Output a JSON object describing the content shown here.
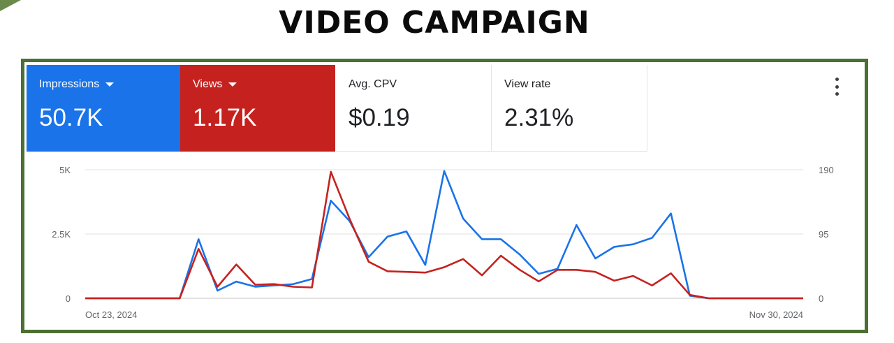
{
  "page": {
    "title": "VIDEO  CAMPAIGN"
  },
  "metrics": [
    {
      "label": "Impressions",
      "value": "50.7K",
      "color": "#1a73e8"
    },
    {
      "label": "Views",
      "value": "1.17K",
      "color": "#c5221f"
    },
    {
      "label": "Avg. CPV",
      "value": "$0.19"
    },
    {
      "label": "View rate",
      "value": "2.31%"
    }
  ],
  "icons": {
    "menu": "more-vert-icon",
    "dropdown": "caret-down-icon"
  },
  "chart_data": {
    "type": "line",
    "x_start_label": "Oct 23, 2024",
    "x_end_label": "Nov 30, 2024",
    "x_range": [
      "2024-10-23",
      "2024-11-30"
    ],
    "left_axis": {
      "ticks": [
        "0",
        "2.5K",
        "5K"
      ],
      "ylim": [
        0,
        5000
      ]
    },
    "right_axis": {
      "ticks": [
        "0",
        "95",
        "190"
      ],
      "ylim": [
        0,
        190
      ]
    },
    "grid": true,
    "series": [
      {
        "name": "Impressions",
        "axis": "left",
        "color": "#1a73e8",
        "values": [
          0,
          0,
          0,
          0,
          0,
          0,
          2300,
          300,
          650,
          450,
          500,
          550,
          750,
          3800,
          3000,
          1600,
          2400,
          2600,
          1300,
          4950,
          3100,
          2300,
          2300,
          1700,
          950,
          1150,
          2850,
          1550,
          2000,
          2100,
          2350,
          3300,
          100,
          0,
          0,
          0,
          0,
          0,
          0
        ]
      },
      {
        "name": "Views",
        "axis": "right",
        "color": "#c5221f",
        "values": [
          0,
          0,
          0,
          0,
          0,
          0,
          73,
          17,
          50,
          20,
          21,
          17,
          16,
          187,
          117,
          54,
          40,
          39,
          38,
          46,
          58,
          34,
          63,
          42,
          25,
          42,
          42,
          39,
          26,
          33,
          19,
          37,
          5,
          0,
          0,
          0,
          0,
          0,
          0
        ]
      }
    ]
  }
}
